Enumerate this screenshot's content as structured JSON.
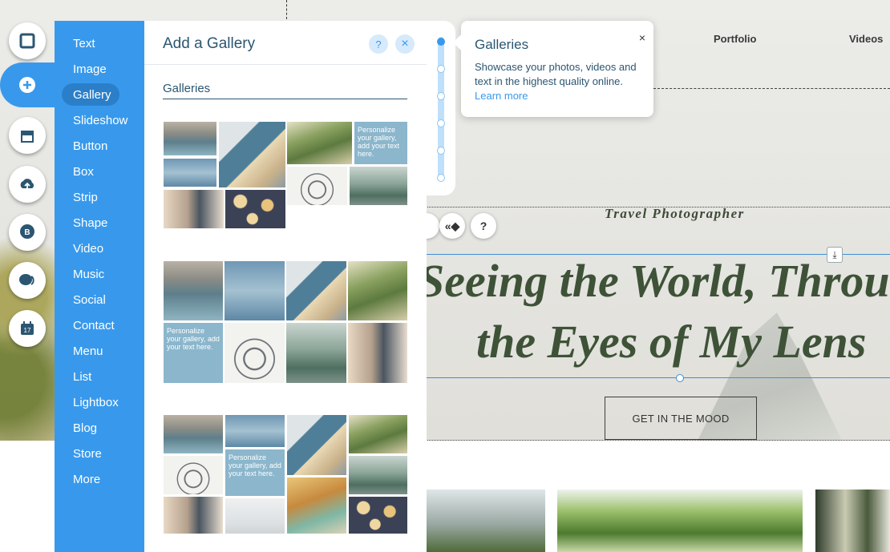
{
  "site": {
    "nav": [
      "Portfolio",
      "Videos"
    ],
    "tagline": "Travel Photographer",
    "headline_line1": "Seeing the World, Throu",
    "headline_line2": "the Eyes of My Lens",
    "cta": "GET IN THE MOOD",
    "download_icon": "⤓",
    "float_buttons": [
      "",
      "«◆",
      "?"
    ]
  },
  "iconbar": {
    "items": [
      "background-icon",
      "add-icon",
      "store-icon",
      "upload-icon",
      "blog-icon",
      "chat-icon",
      "calendar-icon"
    ]
  },
  "categories": {
    "items": [
      "Text",
      "Image",
      "Gallery",
      "Slideshow",
      "Button",
      "Box",
      "Strip",
      "Shape",
      "Video",
      "Music",
      "Social",
      "Contact",
      "Menu",
      "List",
      "Lightbox",
      "Blog",
      "Store",
      "More"
    ],
    "active": "Gallery"
  },
  "panel": {
    "title": "Add a Gallery",
    "help": "?",
    "close": "×",
    "section": "Galleries",
    "placeholder_text": "Personalize your gallery, add your text here."
  },
  "tooltip": {
    "title": "Galleries",
    "body": "Showcase your photos, videos and text in the highest quality online.",
    "link": "Learn more",
    "close": "×"
  },
  "colors": {
    "accent": "#3899ec",
    "panel_text": "#2b5672",
    "headline": "#3e5237"
  }
}
